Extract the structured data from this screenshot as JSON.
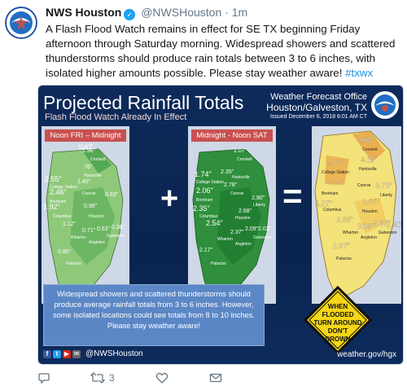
{
  "tweet": {
    "author_name": "NWS Houston",
    "handle": "@NWSHouston",
    "separator": "·",
    "time": "1m",
    "text": "A Flash Flood Watch remains in effect for SE TX beginning Friday afternoon through Saturday morning. Widespread showers and scattered thunderstorms should produce rain totals between 3 to 6 inches, with isolated higher amounts possible. Please stay weather aware!",
    "hashtag": "#txwx"
  },
  "card": {
    "title": "Projected Rainfall Totals",
    "subtitle": "Flash Flood Watch Already In Effect",
    "office_line1": "Weather Forecast Office",
    "office_line2": "Houston/Galveston, TX",
    "issued": "Issued December 6, 2018 6:01 AM CT",
    "panel1_label": "Noon FRI – Midnight SAT",
    "panel2_label": "Midnight - Noon SAT",
    "plus": "+",
    "equals": "=",
    "message": "Widespread showers and scattered thunderstorms should produce average rainfall totals from 3 to 6 inches. However, some isolated locations could see totals from 8 to 10 inches. Please stay weather aware!",
    "sign_text": [
      "WHEN",
      "FLOODED",
      "TURN AROUND",
      "DON'T",
      "DROWN"
    ],
    "footer_handle": "@NWSHouston",
    "footer_site": "weather.gov/hgx"
  },
  "maps": {
    "panel1": {
      "values": [
        "1.96\"",
        ".76\"",
        "2.55\"",
        "1.45\"",
        "2.46\"",
        "1.92\"",
        "0.98\"",
        "0.83\"",
        "1.12\"",
        "0.71\"",
        "0.63\"",
        "0.38\"",
        "0.80\""
      ],
      "cities": [
        "Crockett",
        "Huntsville",
        "College Station",
        "Brenham",
        "Conroe",
        "Columbus",
        "Houston",
        "Wharton",
        "Angleton",
        "Galveston",
        "Palacios"
      ]
    },
    "panel2": {
      "values": [
        "2.07\"",
        "2.35\"",
        "1.74\"",
        "2.78\"",
        "2.06\"",
        "2.90\"",
        "2.35\"",
        "2.68\"",
        "2.54\"",
        "2.37\"",
        "2.09\"",
        "2.02\"",
        "2.17\""
      ],
      "cities": [
        "Crockett",
        "Huntsville",
        "College Station",
        "Brenham",
        "Conroe",
        "Liberty",
        "Columbus",
        "Houston",
        "Wharton",
        "Angleton",
        "Galveston",
        "Palacios"
      ]
    },
    "total": {
      "values": [
        "4.03\"",
        "4.11\"",
        "4.28\"",
        "4.52\"",
        "3.73\"",
        "3.66\"",
        "4.27\"",
        "3.66\"",
        "3.05\"",
        "2.62\"",
        "2.40\"",
        "2.97\""
      ],
      "cities": [
        "Crockett",
        "Huntsville",
        "College Station",
        "Brenham",
        "Conroe",
        "Liberty",
        "Columbus",
        "Houston",
        "Wharton",
        "Angleton",
        "Galveston",
        "Palacios"
      ]
    }
  },
  "actions": {
    "reply_count": "",
    "retweet_count": "3",
    "like_count": ""
  },
  "colors": {
    "panel_green_light": "#8ec97a",
    "panel_green_dark": "#2f8f3c",
    "total_yellow": "#f4e27a",
    "total_orange": "#e9a64a",
    "label_red": "#c8504f",
    "sign_yellow": "#f5d617",
    "link_blue": "#1b95e0"
  }
}
